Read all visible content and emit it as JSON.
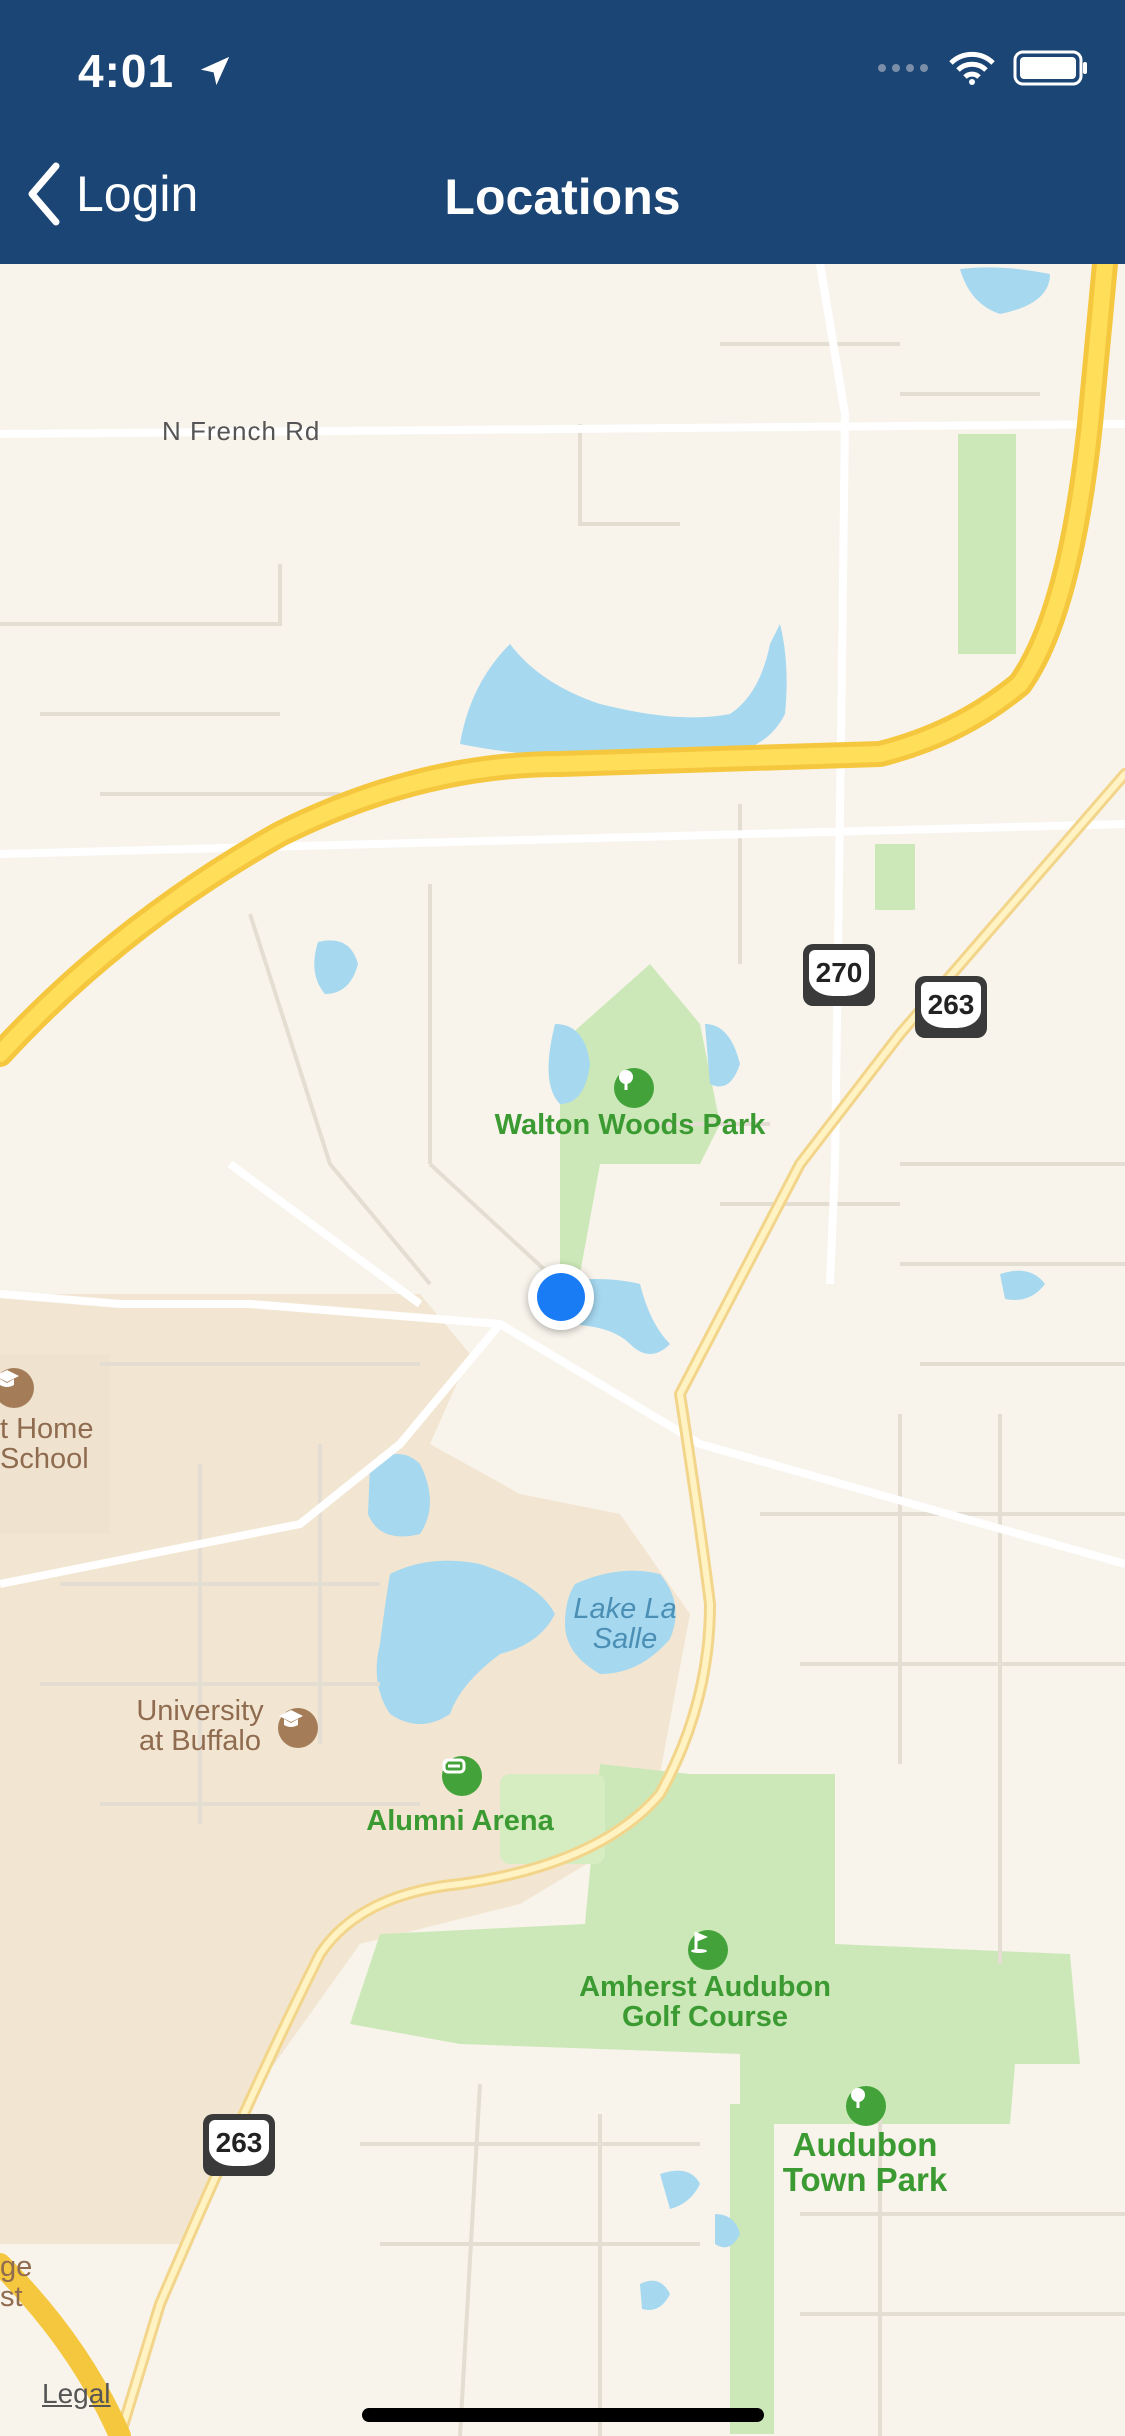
{
  "status_bar": {
    "time": "4:01"
  },
  "nav": {
    "back_label": "Login",
    "title": "Locations"
  },
  "map": {
    "roads": {
      "n_french_rd": "N French Rd"
    },
    "shields": [
      "270",
      "263",
      "263"
    ],
    "places": {
      "walton_woods": "Walton Woods Park",
      "school_line1": "t Home",
      "school_line2": "School",
      "lake_line1": "Lake La",
      "lake_line2": "Salle",
      "ub_line1": "University",
      "ub_line2": "at Buffalo",
      "alumni_arena": "Alumni Arena",
      "golf_line1": "Amherst Audubon",
      "golf_line2": "Golf Course",
      "park_line1": "Audubon",
      "park_line2": "Town Park",
      "edge_line1": "ge",
      "edge_line2": "st"
    },
    "legal": "Legal"
  }
}
